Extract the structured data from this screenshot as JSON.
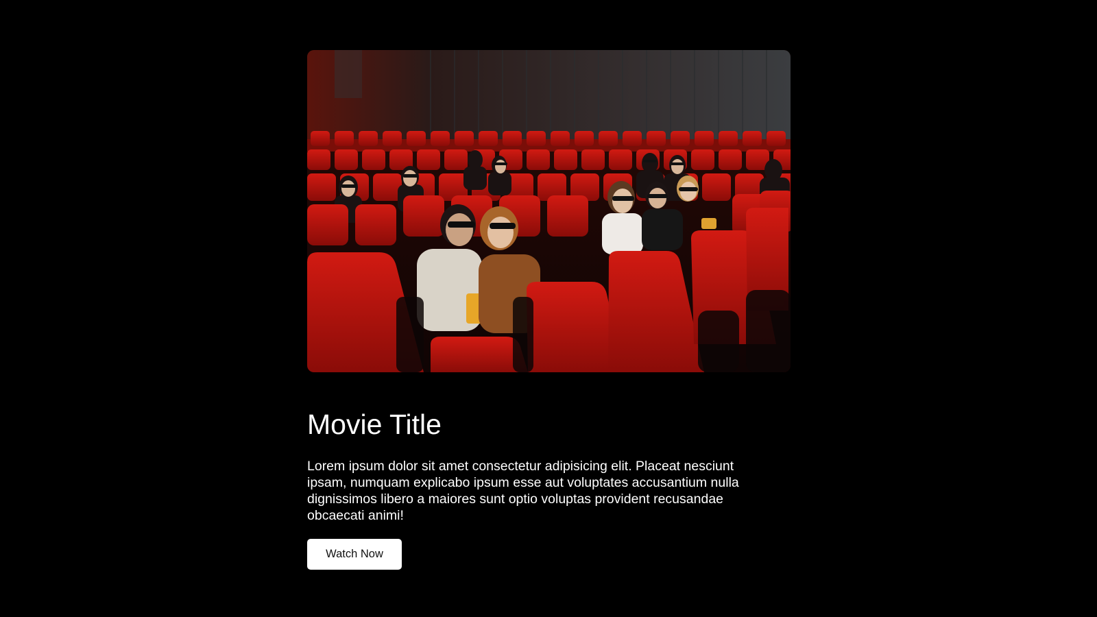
{
  "hero": {
    "image_alt": "People watching a 3D movie in a cinema with red seats"
  },
  "content": {
    "title": "Movie Title",
    "description": "Lorem ipsum dolor sit amet consectetur adipisicing elit. Placeat nesciunt ipsam, numquam explicabo ipsum esse aut voluptates accusantium nulla dignissimos libero a maiores sunt optio voluptas provident recusandae obcaecati animi!",
    "button_label": "Watch Now"
  },
  "colors": {
    "background": "#000000",
    "text": "#ffffff",
    "button_bg": "#ffffff",
    "button_text": "#111111",
    "seat_red": "#c0140f"
  }
}
